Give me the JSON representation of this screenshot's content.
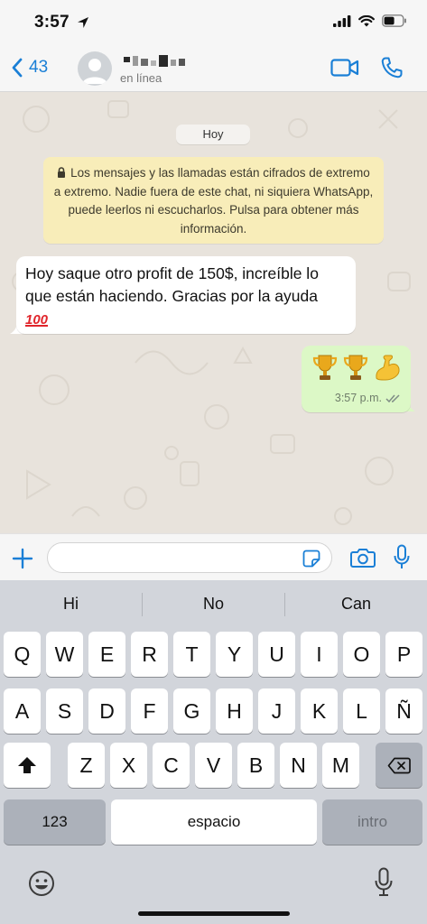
{
  "status_bar": {
    "time": "3:57",
    "icons": [
      "location-arrow-icon",
      "cellular-signal-icon",
      "wifi-icon",
      "battery-icon"
    ]
  },
  "header": {
    "back_count": "43",
    "contact_status": "en línea",
    "icons": [
      "back-chevron-icon",
      "avatar-placeholder-icon",
      "video-call-icon",
      "phone-icon"
    ],
    "accent_color": "#1a7fd6"
  },
  "chat": {
    "date_chip": "Hoy",
    "encryption_notice": "Los mensajes y las llamadas están cifrados de extremo a extremo. Nadie fuera de este chat, ni siquiera WhatsApp, puede leerlos ni escucharlos. Pulsa para obtener más información.",
    "messages": [
      {
        "direction": "incoming",
        "text": "Hoy saque otro profit de 150$, increíble lo que están haciendo. Gracias por la ayuda",
        "emoji": "💯"
      },
      {
        "direction": "outgoing",
        "emoji": [
          "🏆",
          "🏆",
          "💪"
        ],
        "time": "3:57 p.m.",
        "status_icon": "double-check-read-icon"
      }
    ],
    "colors": {
      "incoming_bubble": "#ffffff",
      "outgoing_bubble": "#dcf8c6",
      "notice_bg": "#f8edb9",
      "wallpaper": "#e8e3dc"
    }
  },
  "input_bar": {
    "value": "",
    "icons": [
      "plus-icon",
      "sticker-icon",
      "camera-icon",
      "microphone-icon"
    ]
  },
  "keyboard": {
    "suggestions": [
      "Hi",
      "No",
      "Can"
    ],
    "row1": [
      "Q",
      "W",
      "E",
      "R",
      "T",
      "Y",
      "U",
      "I",
      "O",
      "P"
    ],
    "row2": [
      "A",
      "S",
      "D",
      "F",
      "G",
      "H",
      "J",
      "K",
      "L",
      "Ñ"
    ],
    "row3": [
      "Z",
      "X",
      "C",
      "V",
      "B",
      "N",
      "M"
    ],
    "numbers_key": "123",
    "space_key": "espacio",
    "return_key": "intro",
    "icons": [
      "shift-icon",
      "backspace-icon",
      "emoji-icon",
      "dictation-icon"
    ]
  }
}
